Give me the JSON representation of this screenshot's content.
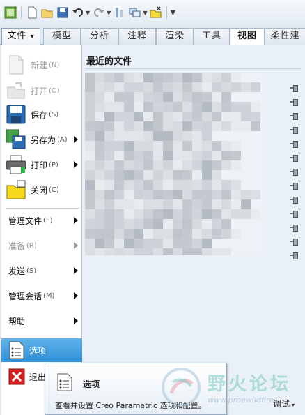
{
  "quick_access": {
    "icons": [
      "app-icon",
      "new-icon",
      "open-icon",
      "save-icon",
      "undo-icon",
      "redo-icon",
      "regenerate-icon",
      "window-icon",
      "close-window-icon",
      "customize-icon"
    ]
  },
  "ribbon": {
    "file_tab": "文件",
    "file_arrow": "▾",
    "tabs": [
      "模型",
      "分析",
      "注释",
      "渲染",
      "工具",
      "视图",
      "柔性建"
    ],
    "active_tab": "视图"
  },
  "file_menu": {
    "items": [
      {
        "label": "新建",
        "key": "(N)",
        "icon": "new-doc-icon",
        "disabled": true
      },
      {
        "label": "打开",
        "key": "(O)",
        "icon": "open-folder-icon",
        "disabled": true
      },
      {
        "label": "保存",
        "key": "(S)",
        "icon": "save-disk-icon",
        "disabled": false
      },
      {
        "label": "另存为",
        "key": "(A)",
        "icon": "save-as-icon",
        "disabled": false,
        "submenu": true
      },
      {
        "label": "打印",
        "key": "(P)",
        "icon": "printer-icon",
        "disabled": false,
        "submenu": true
      },
      {
        "label": "关闭",
        "key": "(C)",
        "icon": "close-folder-icon",
        "disabled": false
      }
    ],
    "text_items": [
      {
        "label": "管理文件",
        "key": "(F)",
        "disabled": false
      },
      {
        "label": "准备",
        "key": "(R)",
        "disabled": true
      },
      {
        "label": "发送",
        "key": "(S)",
        "disabled": false
      },
      {
        "label": "管理会话",
        "key": "(M)",
        "disabled": false
      },
      {
        "label": "帮助",
        "key": "",
        "disabled": false
      }
    ],
    "options_label": "选项",
    "exit_label": "退出"
  },
  "recent_files": {
    "title": "最近的文件",
    "pin_count": 13
  },
  "tooltip": {
    "title": "选项",
    "description": "查看并设置 Creo Parametric 选项和配置。"
  },
  "watermark": {
    "text": "野火论坛",
    "url": "www.proewildfire"
  },
  "status": {
    "debug_label": "调试",
    "debug_arrow": "▾"
  },
  "colors": {
    "selection": "#3a96dc",
    "exit_red": "#d02020"
  }
}
